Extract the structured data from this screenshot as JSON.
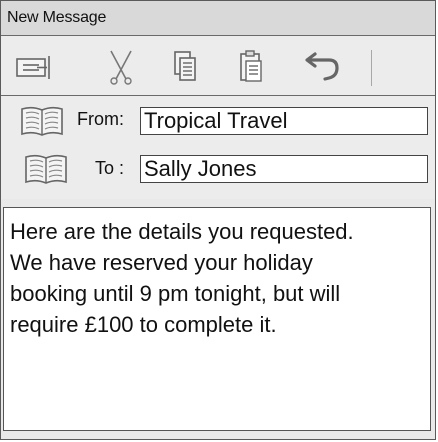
{
  "window": {
    "title": "New Message"
  },
  "toolbar": {
    "buttons": [
      {
        "name": "send",
        "icon": "send-icon"
      },
      {
        "name": "cut",
        "icon": "scissors-icon"
      },
      {
        "name": "copy",
        "icon": "copy-icon"
      },
      {
        "name": "paste",
        "icon": "paste-icon"
      },
      {
        "name": "undo",
        "icon": "undo-icon"
      }
    ]
  },
  "header": {
    "from_label": "From:",
    "from_value": "Tropical Travel",
    "to_label": "To :",
    "to_value": "Sally Jones",
    "address_book_icon": "address-book-icon"
  },
  "message": {
    "body": "Here are the details you requested.\nWe have reserved your holiday\nbooking until 9 pm tonight, but will\nrequire £100 to complete it."
  }
}
